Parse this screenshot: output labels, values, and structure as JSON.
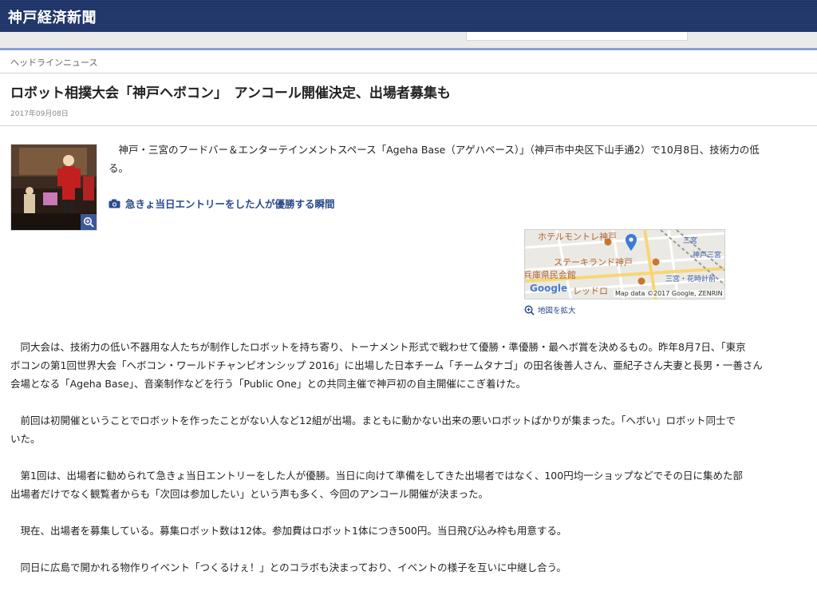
{
  "header": {
    "site_name": "神戸経済新聞"
  },
  "section": {
    "label": "ヘッドラインニュース"
  },
  "article": {
    "title": "ロボット相撲大会「神戸ヘボコン」　アンコール開催決定、出場者募集も",
    "date": "2017年09月08日",
    "lead_line1": "　神戸・三宮のフードバー＆エンターテインメントスペース「Ageha Base（アゲハベース）」（神戸市中央区下山手通2）で10月8日、技術力の低",
    "lead_line2": "る。",
    "photo_caption": "急きょ当日エントリーをした人が優勝する瞬間",
    "paragraphs": [
      [
        "　同大会は、技術力の低い不器用な人たちが制作したロボットを持ち寄り、トーナメント形式で戦わせて優勝・準優勝・最ヘボ賞を決めるもの。昨年8月7日、「東京",
        "ボコンの第1回世界大会「ヘボコン・ワールドチャンピオンシップ 2016」に出場した日本チーム「チームタナゴ」の田名後善人さん、亜紀子さん夫妻と長男・一善さん",
        "会場となる「Ageha Base」、音楽制作などを行う「Public One」との共同主催で神戸初の自主開催にこぎ着けた。"
      ],
      [
        "　前回は初開催ということでロボットを作ったことがない人など12組が出場。まともに動かない出来の悪いロボットばかりが集まった。「へボい」ロボット同士で",
        "いた。"
      ],
      [
        "　第1回は、出場者に勧められて急きょ当日エントリーをした人が優勝。当日に向けて準備をしてきた出場者ではなく、100円均一ショップなどでその日に集めた部",
        "出場者だけでなく観覧者からも「次回は参加したい」という声も多く、今回のアンコール開催が決まった。"
      ],
      [
        "　現在、出場者を募集している。募集ロボット数は12体。参加費はロボット1体につき500円。当日飛び込み枠も用意する。"
      ],
      [
        "　同日に広島で開かれる物作りイベント「つくるけぇ！」とのコラボも決まっており、イベントの様子を互いに中継し合う。"
      ]
    ]
  },
  "map": {
    "labels": {
      "hotel": "ホテルモントレ神戸",
      "steakland": "ステーキランド神戸",
      "hall": "兵庫県民会館",
      "redlobster": "レッドロ",
      "sannomiya": "三宮",
      "kobe_sannomiya": "神戸三宮",
      "hanadokei": "三宮・花時計前"
    },
    "google": "Google",
    "credit": "Map data ©2017 Google, ZENRIN",
    "zoom_link": "地図を拡大"
  }
}
